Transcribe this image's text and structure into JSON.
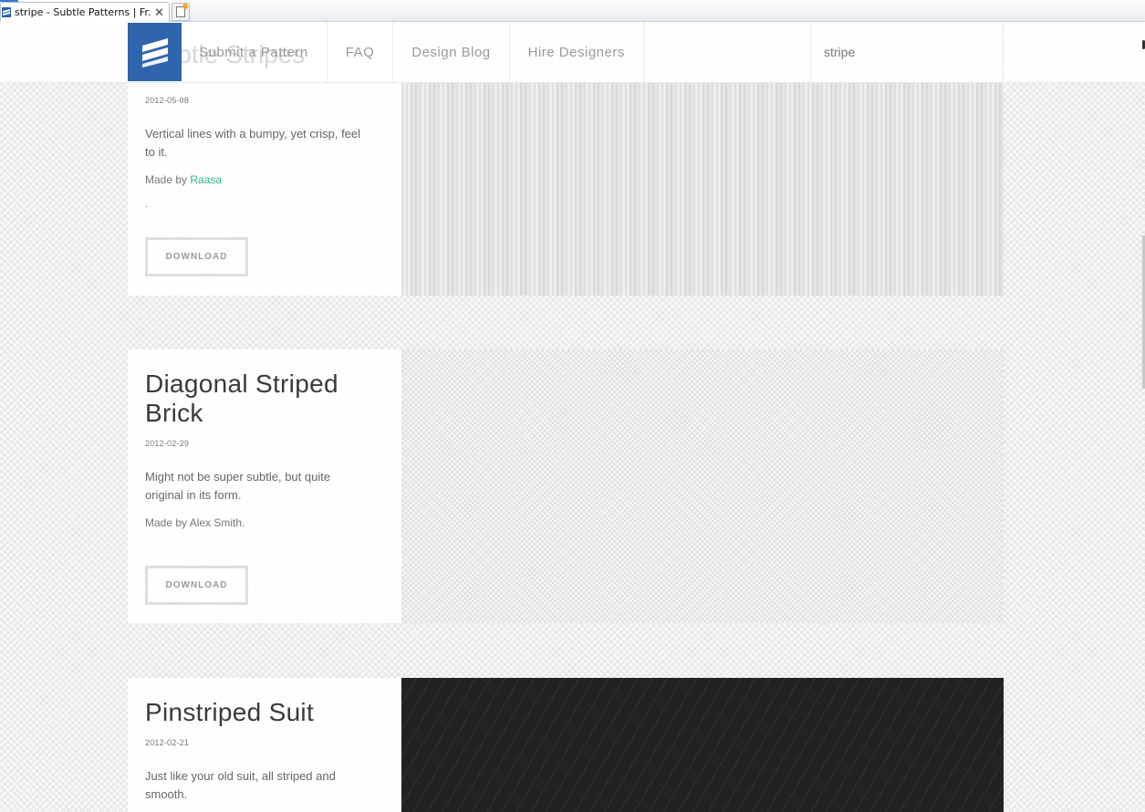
{
  "browser": {
    "tab_title": "stripe - Subtle Patterns | Fr...",
    "tab_close_glyph": "✕",
    "new_tab_icon": "new-tab-icon"
  },
  "header": {
    "logo_icon": "stripes-logo-icon",
    "overlapped_title": "Subtle Stripes",
    "nav": [
      {
        "label": "Submit a Pattern"
      },
      {
        "label": "FAQ"
      },
      {
        "label": "Design Blog"
      },
      {
        "label": "Hire Designers"
      }
    ],
    "search": {
      "value": "stripe"
    }
  },
  "patterns": [
    {
      "title": "Subtle Stripes",
      "date": "2012-05-08",
      "description": "Vertical lines with a bumpy, yet crisp, feel to it.",
      "made_by_prefix": "Made by ",
      "author": "Raasa",
      "trailing": ".",
      "download_label": "DOWNLOAD"
    },
    {
      "title": "Diagonal Striped Brick",
      "date": "2012-02-29",
      "description": "Might not be super subtle, but quite original in its form.",
      "made_by": "Made by Alex Smith.",
      "download_label": "DOWNLOAD"
    },
    {
      "title": "Pinstriped Suit",
      "date": "2012-02-21",
      "description": "Just like your old suit, all striped and smooth."
    }
  ],
  "colors": {
    "logo_blue": "#2f65ad",
    "link_green": "#2fb295",
    "suit_dark": "#222222"
  }
}
